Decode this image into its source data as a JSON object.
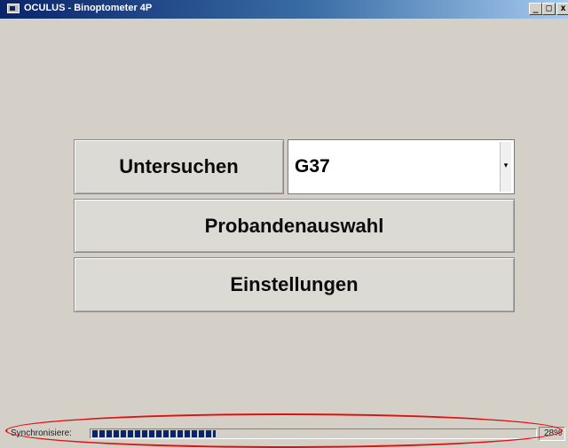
{
  "window": {
    "title": "OCULUS - Binoptometer 4P",
    "controls": {
      "minimize": "_",
      "maximize": "□",
      "close": "x"
    }
  },
  "main": {
    "examine_button": "Untersuchen",
    "device_combo": {
      "value": "G37",
      "arrow": "▾"
    },
    "subject_select_button": "Probandenauswahl",
    "settings_button": "Einstellungen"
  },
  "status": {
    "label": "Synchronisiere:",
    "progress_fraction": 0.28,
    "progress_text": "28%"
  },
  "colors": {
    "progress_fill": "#0a246a",
    "highlight": "#e01010"
  }
}
